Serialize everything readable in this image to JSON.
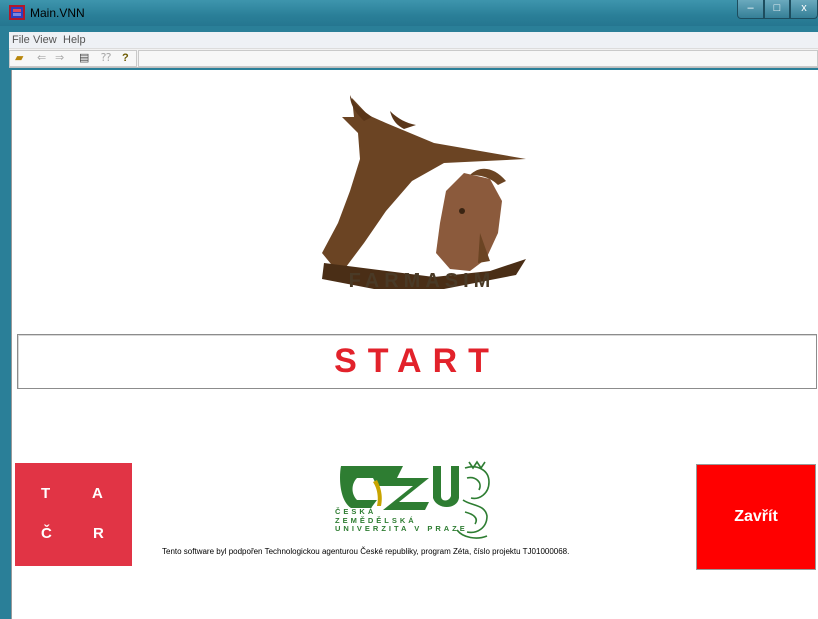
{
  "window": {
    "title": "Main.VNN",
    "controls": {
      "minimize": "–",
      "maximize": "□",
      "close": "x"
    }
  },
  "menubar": {
    "items": [
      "File",
      "View",
      "Help"
    ]
  },
  "toolbar": {
    "icons": [
      "open-folder-icon",
      "back-arrow-icon",
      "forward-arrow-icon",
      "print-icon",
      "context-help-icon",
      "help-icon"
    ],
    "glyphs": {
      "open": "▰",
      "back": "⇐",
      "forward": "⇒",
      "print": "▤",
      "context_help": "⁇",
      "help": "?"
    }
  },
  "logo": {
    "text": "FARMASIM"
  },
  "start": {
    "label": "START"
  },
  "tacr": {
    "t": "T",
    "a": "A",
    "c": "Č",
    "r": "R"
  },
  "czu": {
    "line1": "ČESKÁ",
    "line2": "ZEMĚDĚLSKÁ",
    "line3": "UNIVERZITA V PRAZE"
  },
  "support_text": "Tento software byl podpořen Technologickou agenturou České republiky, program Zéta, číslo projektu TJ01000068.",
  "close_button": {
    "label": "Zavřít"
  },
  "colors": {
    "frame": "#2a7f98",
    "start_text": "#e2222b",
    "tacr_bg": "#e13445",
    "close_bg": "#ff0000",
    "czu_green": "#2e7d32"
  }
}
